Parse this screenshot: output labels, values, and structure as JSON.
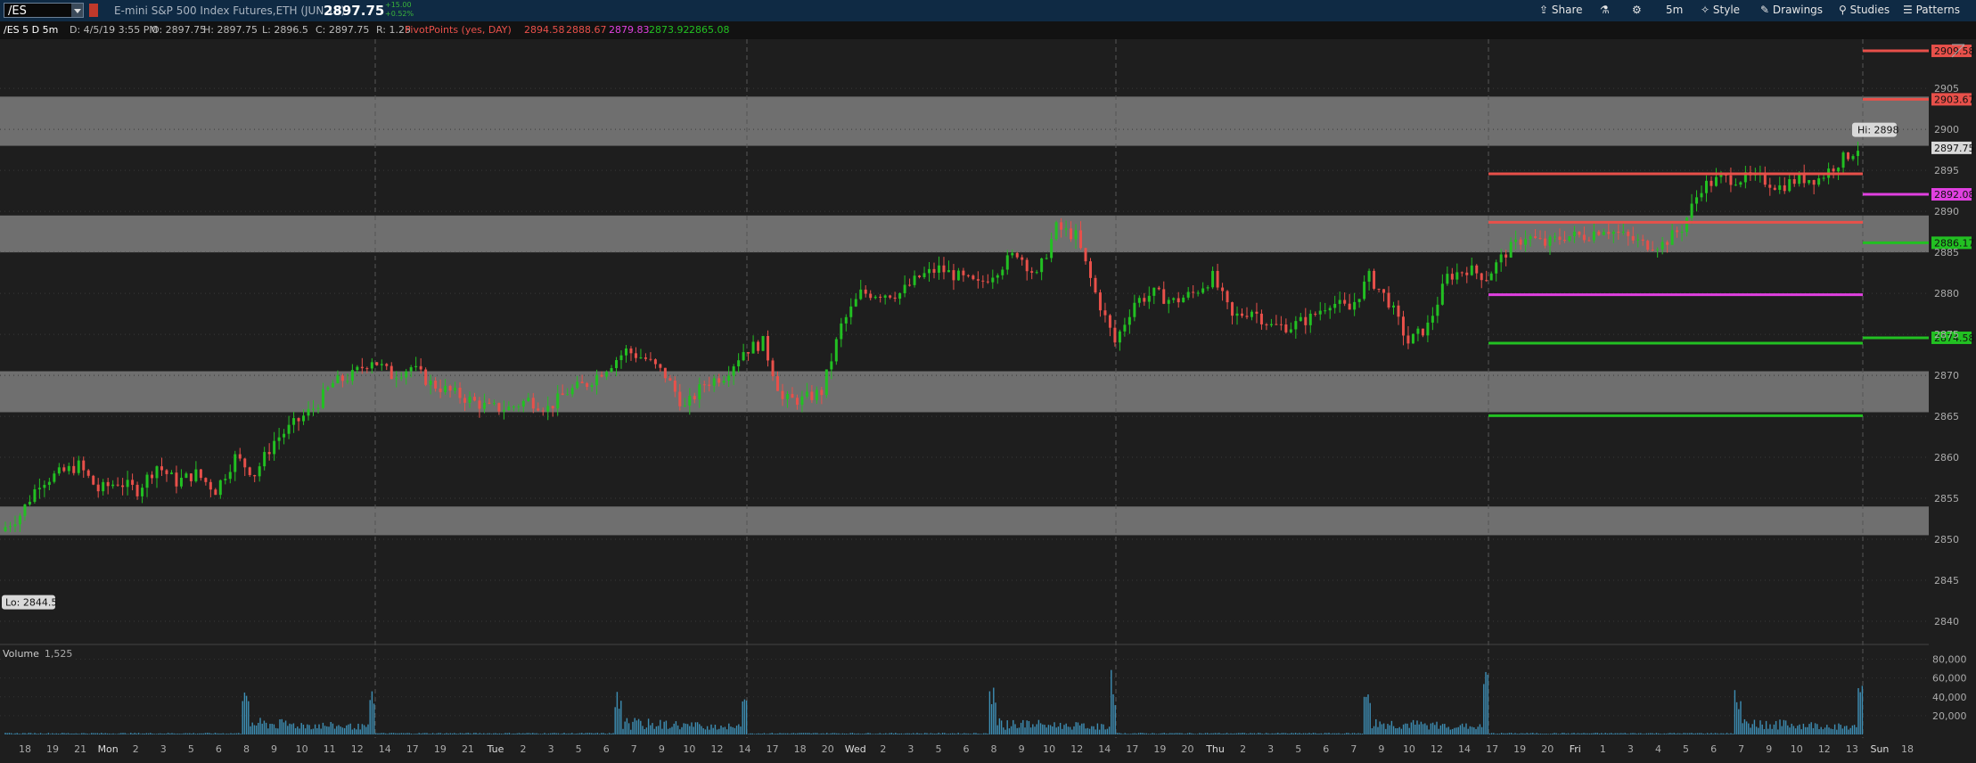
{
  "toolbar": {
    "symbol": "/ES",
    "description": "E-mini S&P 500 Index Futures,ETH (JUN 19)",
    "last_price": "2897.75",
    "change": "+15.00",
    "change_pct": "+0.52%",
    "share_label": "Share",
    "timeframe_label": "5m",
    "style_label": "Style",
    "drawings_label": "Drawings",
    "studies_label": "Studies",
    "patterns_label": "Patterns"
  },
  "infobar": {
    "title": "/ES 5 D 5m",
    "date": "D: 4/5/19 3:55 PM",
    "open": "O: 2897.75",
    "high": "H: 2897.75",
    "low": "L: 2896.5",
    "close": "C: 2897.75",
    "range": "R: 1.25",
    "study": "PivotPoints (yes, DAY)",
    "pivots": [
      "2894.58",
      "2888.67",
      "2879.83",
      "2873.92",
      "2865.08"
    ]
  },
  "chart_data": {
    "type": "candlestick",
    "y_ticks": [
      2840,
      2845,
      2850,
      2855,
      2860,
      2865,
      2870,
      2875,
      2880,
      2885,
      2890,
      2895,
      2900,
      2905
    ],
    "ylim": [
      2837.5,
      2911
    ],
    "x_tick_labels": [
      "18",
      "19",
      "21",
      "Mon",
      "2",
      "3",
      "5",
      "6",
      "8",
      "9",
      "10",
      "11",
      "12",
      "14",
      "17",
      "19",
      "21",
      "Tue",
      "2",
      "3",
      "5",
      "6",
      "7",
      "9",
      "10",
      "12",
      "14",
      "17",
      "18",
      "20",
      "Wed",
      "2",
      "3",
      "5",
      "6",
      "8",
      "9",
      "10",
      "12",
      "14",
      "17",
      "19",
      "20",
      "Thu",
      "2",
      "3",
      "5",
      "6",
      "7",
      "9",
      "10",
      "12",
      "14",
      "17",
      "19",
      "20",
      "Fri",
      "1",
      "3",
      "4",
      "5",
      "6",
      "7",
      "9",
      "10",
      "12",
      "13",
      "Sun",
      "18"
    ],
    "day_labels": [
      "Mon",
      "Tue",
      "Wed",
      "Thu",
      "Fri"
    ],
    "zones": [
      {
        "from": 2898,
        "to": 2904
      },
      {
        "from": 2885,
        "to": 2889.5
      },
      {
        "from": 2865.5,
        "to": 2870.5
      },
      {
        "from": 2850.5,
        "to": 2854
      }
    ],
    "pivot_lines": [
      {
        "value": 2894.58,
        "color": "#e8504a",
        "label": ""
      },
      {
        "value": 2888.67,
        "color": "#e8504a",
        "label": ""
      },
      {
        "value": 2879.83,
        "color": "#e040e0",
        "label": ""
      },
      {
        "value": 2873.92,
        "color": "#22c022",
        "label": ""
      },
      {
        "value": 2865.08,
        "color": "#22c022",
        "label": ""
      }
    ],
    "future_pivots": [
      {
        "value": 2909.58,
        "color": "#e8504a",
        "label": "2909.58"
      },
      {
        "value": 2903.67,
        "color": "#e8504a",
        "label": "2903.67"
      },
      {
        "value": 2892.08,
        "color": "#e040e0",
        "label": "2892.08"
      },
      {
        "value": 2886.17,
        "color": "#22c022",
        "label": "2886.17"
      },
      {
        "value": 2874.58,
        "color": "#22c022",
        "label": "2874.58"
      }
    ],
    "last_price_label": "2897.75",
    "hi_label": "Hi: 2898",
    "lo_label": "Lo: 2844.5",
    "price_path": [
      [
        0,
        2851
      ],
      [
        1,
        2853
      ],
      [
        2,
        2857
      ],
      [
        3,
        2858
      ],
      [
        4,
        2859
      ],
      [
        5,
        2856
      ],
      [
        6,
        2857
      ],
      [
        7,
        2856
      ],
      [
        8,
        2859
      ],
      [
        9,
        2857
      ],
      [
        10,
        2858
      ],
      [
        11,
        2856
      ],
      [
        12,
        2860
      ],
      [
        13,
        2858
      ],
      [
        14,
        2862
      ],
      [
        15,
        2864
      ],
      [
        16,
        2866
      ],
      [
        17,
        2869
      ],
      [
        18,
        2870
      ],
      [
        19,
        2872
      ],
      [
        20,
        2870
      ],
      [
        21,
        2871
      ],
      [
        22,
        2869
      ],
      [
        23,
        2868
      ],
      [
        24,
        2867
      ],
      [
        25,
        2866
      ],
      [
        26,
        2866
      ],
      [
        27,
        2867
      ],
      [
        28,
        2866
      ],
      [
        29,
        2868
      ],
      [
        30,
        2869
      ],
      [
        31,
        2871
      ],
      [
        32,
        2873
      ],
      [
        33,
        2872
      ],
      [
        34,
        2870
      ],
      [
        35,
        2866
      ],
      [
        36,
        2869
      ],
      [
        37,
        2870
      ],
      [
        38,
        2873
      ],
      [
        39,
        2874
      ],
      [
        40,
        2867
      ],
      [
        41,
        2867
      ],
      [
        42,
        2868
      ],
      [
        43,
        2876
      ],
      [
        44,
        2880
      ],
      [
        45,
        2880
      ],
      [
        46,
        2880
      ],
      [
        47,
        2882
      ],
      [
        48,
        2883
      ],
      [
        49,
        2882
      ],
      [
        50,
        2881
      ],
      [
        51,
        2883
      ],
      [
        52,
        2885
      ],
      [
        53,
        2882
      ],
      [
        54,
        2888
      ],
      [
        55,
        2887
      ],
      [
        56,
        2880
      ],
      [
        57,
        2874
      ],
      [
        58,
        2879
      ],
      [
        59,
        2880
      ],
      [
        60,
        2879
      ],
      [
        61,
        2880
      ],
      [
        62,
        2882
      ],
      [
        63,
        2877
      ],
      [
        64,
        2878
      ],
      [
        65,
        2876
      ],
      [
        66,
        2876
      ],
      [
        67,
        2877
      ],
      [
        68,
        2879
      ],
      [
        69,
        2878
      ],
      [
        70,
        2882
      ],
      [
        71,
        2879
      ],
      [
        72,
        2874
      ],
      [
        73,
        2876
      ],
      [
        74,
        2882
      ],
      [
        75,
        2883
      ],
      [
        76,
        2882
      ],
      [
        77,
        2885
      ],
      [
        78,
        2887
      ],
      [
        79,
        2886
      ],
      [
        80,
        2887
      ],
      [
        81,
        2887
      ],
      [
        82,
        2888
      ],
      [
        83,
        2887
      ],
      [
        84,
        2886
      ],
      [
        85,
        2886
      ],
      [
        86,
        2888
      ],
      [
        87,
        2893
      ],
      [
        88,
        2894
      ],
      [
        89,
        2894
      ],
      [
        90,
        2894
      ],
      [
        91,
        2893
      ],
      [
        92,
        2894
      ],
      [
        93,
        2894
      ],
      [
        94,
        2896
      ],
      [
        95,
        2897.75
      ]
    ],
    "volume": {
      "label": "Volume",
      "value": "1,525",
      "y_ticks": [
        "80,000",
        "60,000",
        "40,000",
        "20,000"
      ],
      "ylim": [
        0,
        90000
      ]
    }
  }
}
